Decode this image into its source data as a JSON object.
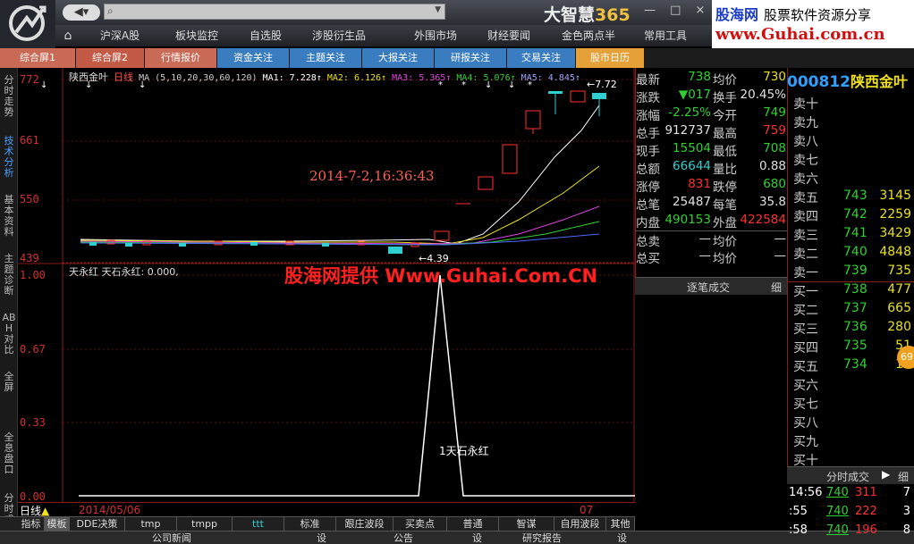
{
  "header": {
    "brand_text": "大智慧",
    "brand_num": "365",
    "window_buttons": "— □ ×",
    "search_placeholder": "",
    "menu": [
      "沪深A股",
      "板块监控",
      "自选股",
      "涉股衍生品",
      "外围市场",
      "财经要闻",
      "金色两点半",
      "常用工具"
    ],
    "ad_line1_a": "股海网",
    "ad_line1_b": "股票软件资源分享",
    "ad_line2": "www.Guhai.com.cn"
  },
  "tabs": [
    "综合屏1",
    "综合屏2",
    "行情报价",
    "资金关注",
    "主题关注",
    "大报关注",
    "研报关注",
    "交易关注",
    "股市日历"
  ],
  "left_tabs": [
    "分时走势",
    "技术分析",
    "基本资料",
    "主题诊断",
    "ABH对比",
    "全屏",
    "全息盘口",
    "分时成交"
  ],
  "kline": {
    "stock_name": "陕西金叶",
    "period": "日线",
    "ma_label": "MA (5,10,20,30,60,120)",
    "ma_values": [
      {
        "name": "MA1",
        "value": "7.228",
        "color": "#ffffff"
      },
      {
        "name": "MA2",
        "value": "6.126",
        "color": "#e8e020"
      },
      {
        "name": "MA3",
        "value": "5.365",
        "color": "#e040e0"
      },
      {
        "name": "MA4",
        "value": "5.076",
        "color": "#30d030"
      },
      {
        "name": "MA5",
        "value": "4.845",
        "color": "#a0a0ff"
      },
      {
        "name": "MA6",
        "value": "",
        "color": "#4a6aff"
      }
    ],
    "y_labels": [
      "772",
      "661",
      "550",
      "439"
    ],
    "high_mark": "7.72",
    "low_mark": "4.39",
    "annotation": "2014-7-2,16:36:43"
  },
  "indicator": {
    "name": "天永红",
    "title": "天石永红: 0.000,",
    "y_labels": [
      "1.00",
      "0.67",
      "0.33",
      "0.00"
    ],
    "peak_label": "1天石永红"
  },
  "watermark": "股海网提供 Www.Guhai.Com.CN",
  "datebar": {
    "label": "日线",
    "start": "2014/05/06",
    "end": "07"
  },
  "bottom_tabs": [
    "指标",
    "模板",
    "DDE决策",
    "tmp",
    "tmpp",
    "ttt",
    "标准",
    "跟庄波段",
    "买卖点",
    "普通",
    "智谋",
    "自用波段",
    "其他"
  ],
  "bottom_bar": [
    "公司新闻",
    "设",
    "公告",
    "设",
    "研究报告",
    "设"
  ],
  "quote": {
    "rows": [
      {
        "l": "最新",
        "v1": "738",
        "c1": "green",
        "l2": "均价",
        "v2": "730",
        "c2": "yel"
      },
      {
        "l": "涨跌",
        "v1": "▼017",
        "c1": "green",
        "l2": "换手",
        "v2": "20.45%",
        "c2": "wht"
      },
      {
        "l": "涨幅",
        "v1": "-2.25%",
        "c1": "green",
        "l2": "今开",
        "v2": "749",
        "c2": "green"
      },
      {
        "l": "总手",
        "v1": "912737",
        "c1": "wht",
        "l2": "最高",
        "v2": "759",
        "c2": "red"
      },
      {
        "l": "现手",
        "v1": "15504",
        "c1": "green",
        "l2": "最低",
        "v2": "708",
        "c2": "green"
      },
      {
        "l": "总额",
        "v1": "66644",
        "c1": "cyan",
        "l2": "量比",
        "v2": "0.88",
        "c2": "wht"
      },
      {
        "l": "涨停",
        "v1": "831",
        "c1": "red",
        "l2": "跌停",
        "v2": "680",
        "c2": "green"
      },
      {
        "l": "总笔",
        "v1": "25487",
        "c1": "wht",
        "l2": "每笔",
        "v2": "35.8",
        "c2": "wht"
      },
      {
        "l": "内盘",
        "v1": "490153",
        "c1": "green",
        "l2": "外盘",
        "v2": "422584",
        "c2": "red"
      },
      {
        "l": "总卖",
        "v1": "—",
        "c1": "wht",
        "l2": "均价",
        "v2": "—",
        "c2": "wht"
      },
      {
        "l": "总买",
        "v1": "—",
        "c1": "wht",
        "l2": "均价",
        "v2": "—",
        "c2": "wht"
      }
    ],
    "tick_button": "逐笔成交",
    "tick_detail": "细"
  },
  "book": {
    "code": "000812",
    "name": "陕西金叶",
    "sells": [
      {
        "l": "卖十",
        "p": "",
        "q": ""
      },
      {
        "l": "卖九",
        "p": "",
        "q": ""
      },
      {
        "l": "卖八",
        "p": "",
        "q": ""
      },
      {
        "l": "卖七",
        "p": "",
        "q": ""
      },
      {
        "l": "卖六",
        "p": "",
        "q": ""
      },
      {
        "l": "卖五",
        "p": "743",
        "q": "3145"
      },
      {
        "l": "卖四",
        "p": "742",
        "q": "2259"
      },
      {
        "l": "卖三",
        "p": "741",
        "q": "3429"
      },
      {
        "l": "卖二",
        "p": "740",
        "q": "4848"
      },
      {
        "l": "卖一",
        "p": "739",
        "q": "735"
      }
    ],
    "buys": [
      {
        "l": "买一",
        "p": "738",
        "q": "477"
      },
      {
        "l": "买二",
        "p": "737",
        "q": "665"
      },
      {
        "l": "买三",
        "p": "736",
        "q": "280"
      },
      {
        "l": "买四",
        "p": "735",
        "q": "51"
      },
      {
        "l": "买五",
        "p": "734",
        "q": "13"
      },
      {
        "l": "买六",
        "p": "",
        "q": ""
      },
      {
        "l": "买七",
        "p": "",
        "q": ""
      },
      {
        "l": "买八",
        "p": "",
        "q": ""
      },
      {
        "l": "买九",
        "p": "",
        "q": ""
      },
      {
        "l": "买十",
        "p": "",
        "q": ""
      }
    ],
    "fen_label": "分时成交",
    "fen_detail": "细",
    "circle_badge": "69",
    "trades": [
      {
        "t": "14:56",
        "p": "740",
        "q": "311",
        "n": "7"
      },
      {
        "t": ":55",
        "p": "740",
        "q": "222",
        "n": "3"
      },
      {
        "t": ":58",
        "p": "740",
        "q": "196",
        "n": "8"
      }
    ]
  },
  "colors": {
    "up": "#ff3030",
    "down": "#30d030",
    "ma1": "#ffffff",
    "ma2": "#e8e020",
    "ma3": "#e040e0",
    "ma4": "#30d030",
    "ma5": "#4a6aff",
    "accent": "#8a1c1c"
  }
}
